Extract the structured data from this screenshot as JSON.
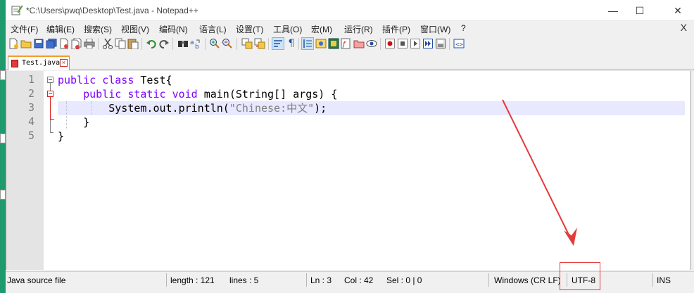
{
  "window": {
    "title": "*C:\\Users\\pwq\\Desktop\\Test.java - Notepad++",
    "controls": {
      "minimize": "—",
      "maximize": "☐",
      "close": "✕"
    }
  },
  "menu": {
    "items": [
      "文件(F)",
      "编辑(E)",
      "搜索(S)",
      "视图(V)",
      "编码(N)",
      "语言(L)",
      "设置(T)",
      "工具(O)",
      "宏(M)",
      "运行(R)",
      "插件(P)",
      "窗口(W)",
      "?"
    ],
    "close": "X"
  },
  "tab": {
    "label": "Test.java"
  },
  "editor": {
    "line_numbers": [
      "1",
      "2",
      "3",
      "4",
      "5"
    ],
    "lines": {
      "l1": {
        "kw1": "public",
        "kw2": "class",
        "rest": " Test{"
      },
      "l2": {
        "indent": "    ",
        "kw1": "public",
        "kw2": "static",
        "kw3": "void",
        "rest": " main(String[] args) {"
      },
      "l3": {
        "indent": "        ",
        "pre": "System.out.println(",
        "str": "\"Chinese:中文\"",
        "post": ");"
      },
      "l4": {
        "indent": "    ",
        "text": "}"
      },
      "l5": {
        "text": "}"
      }
    }
  },
  "status": {
    "file_type": "Java source file",
    "length": "length : 121",
    "lines": "lines : 5",
    "ln": "Ln : 3",
    "col": "Col : 42",
    "sel": "Sel : 0 | 0",
    "eol": "Windows (CR LF)",
    "encoding": "UTF-8",
    "mode": "INS"
  },
  "colors": {
    "keyword": "#8000ff",
    "string": "#808080",
    "annotation": "#e23b3b",
    "current_line": "#e8e8ff"
  }
}
